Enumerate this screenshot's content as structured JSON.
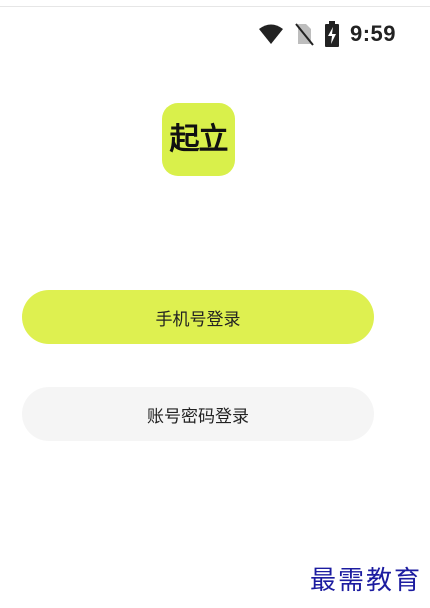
{
  "status_bar": {
    "time": "9:59",
    "icons": [
      "wifi-icon",
      "no-sim-icon",
      "battery-charging-icon"
    ]
  },
  "logo": {
    "text": "起立",
    "color": "#d9f04b"
  },
  "buttons": {
    "phone_login": "手机号登录",
    "account_login": "账号密码登录"
  },
  "watermark": {
    "text": "最需教育",
    "color": "#1c1ca0"
  },
  "colors": {
    "accent": "#def050",
    "secondary_button": "#f5f5f5",
    "background": "#ffffff"
  }
}
